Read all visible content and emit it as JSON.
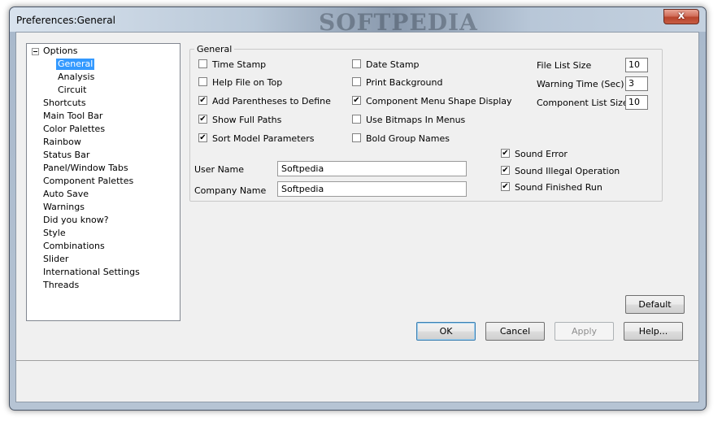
{
  "window": {
    "title": "Preferences:General",
    "watermark": "SOFTPEDIA",
    "close_label": "x"
  },
  "tree": {
    "root": "Options",
    "children": [
      "General",
      "Analysis",
      "Circuit"
    ],
    "items": [
      "Shortcuts",
      "Main Tool Bar",
      "Color Palettes",
      "Rainbow",
      "Status Bar",
      "Panel/Window Tabs",
      "Component Palettes",
      "Auto Save",
      "Warnings",
      "Did you know?",
      "Style",
      "Combinations",
      "Slider",
      "International Settings",
      "Threads"
    ],
    "selected": "General"
  },
  "general": {
    "legend": "General",
    "checkboxes": [
      {
        "label": "Time Stamp",
        "checked": false
      },
      {
        "label": "Help File on Top",
        "checked": false
      },
      {
        "label": "Add Parentheses to Define",
        "checked": true
      },
      {
        "label": "Show Full Paths",
        "checked": true
      },
      {
        "label": "Sort Model Parameters",
        "checked": true
      },
      {
        "label": "Date Stamp",
        "checked": false
      },
      {
        "label": "Print Background",
        "checked": false
      },
      {
        "label": "Component Menu Shape Display",
        "checked": true
      },
      {
        "label": "Use Bitmaps In Menus",
        "checked": false
      },
      {
        "label": "Bold Group Names",
        "checked": false
      },
      {
        "label": "Sound Error",
        "checked": true
      },
      {
        "label": "Sound Illegal Operation",
        "checked": true
      },
      {
        "label": "Sound Finished Run",
        "checked": true
      }
    ],
    "fields": {
      "file_list_size_label": "File List Size",
      "file_list_size": "10",
      "warning_time_label": "Warning Time (Sec)",
      "warning_time": "3",
      "component_list_size_label": "Component List Size",
      "component_list_size": "10",
      "user_name_label": "User Name",
      "user_name": "Softpedia",
      "company_name_label": "Company Name",
      "company_name": "Softpedia"
    }
  },
  "buttons": {
    "default": "Default",
    "ok": "OK",
    "cancel": "Cancel",
    "apply": "Apply",
    "help": "Help..."
  },
  "colors": {
    "selection": "#3399ff",
    "close_button": "#c75d44"
  }
}
